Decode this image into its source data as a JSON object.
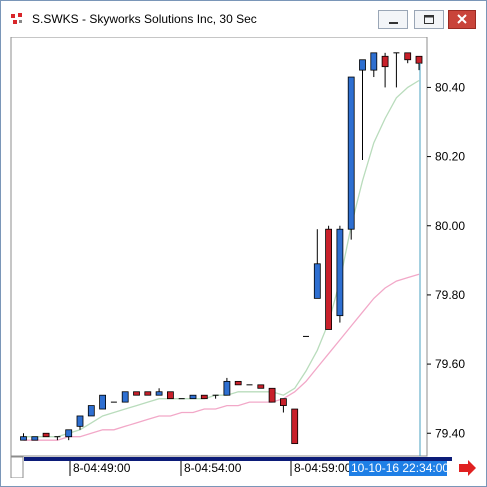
{
  "window": {
    "title": "S.SWKS - Skyworks Solutions Inc, 30 Sec",
    "colors": {
      "up": "#2e6fd1",
      "down": "#c8202a",
      "ma_fast": "#b9dcbc",
      "ma_slow": "#f2a8c8",
      "cursor": "#4aa0c0",
      "time_highlight": "#1e7fe6",
      "scroll_bar": "#0c1c78"
    }
  },
  "chart_data": {
    "type": "candlestick",
    "ylim": [
      79.34,
      80.54
    ],
    "y_ticks": [
      "80.40",
      "80.20",
      "80.00",
      "79.80",
      "79.60",
      "79.40"
    ],
    "x_labels": [
      "8-04:49:00",
      "8-04:54:00",
      "8-04:59:00"
    ],
    "cursor_time": "10-10-16 22:34:00",
    "candles": [
      {
        "o": 79.38,
        "h": 79.4,
        "l": 79.38,
        "c": 79.39
      },
      {
        "o": 79.38,
        "h": 79.39,
        "l": 79.38,
        "c": 79.39
      },
      {
        "o": 79.4,
        "h": 79.4,
        "l": 79.39,
        "c": 79.39
      },
      {
        "o": 79.39,
        "h": 79.39,
        "l": 79.38,
        "c": 79.39
      },
      {
        "o": 79.39,
        "h": 79.41,
        "l": 79.38,
        "c": 79.41
      },
      {
        "o": 79.42,
        "h": 79.45,
        "l": 79.41,
        "c": 79.45
      },
      {
        "o": 79.45,
        "h": 79.48,
        "l": 79.45,
        "c": 79.48
      },
      {
        "o": 79.47,
        "h": 79.51,
        "l": 79.47,
        "c": 79.51
      },
      {
        "o": 79.49,
        "h": 79.49,
        "l": 79.49,
        "c": 79.49
      },
      {
        "o": 79.49,
        "h": 79.52,
        "l": 79.49,
        "c": 79.52
      },
      {
        "o": 79.52,
        "h": 79.52,
        "l": 79.51,
        "c": 79.51
      },
      {
        "o": 79.52,
        "h": 79.52,
        "l": 79.51,
        "c": 79.51
      },
      {
        "o": 79.51,
        "h": 79.53,
        "l": 79.51,
        "c": 79.52
      },
      {
        "o": 79.52,
        "h": 79.52,
        "l": 79.5,
        "c": 79.5
      },
      {
        "o": 79.5,
        "h": 79.5,
        "l": 79.5,
        "c": 79.5
      },
      {
        "o": 79.5,
        "h": 79.51,
        "l": 79.5,
        "c": 79.51
      },
      {
        "o": 79.51,
        "h": 79.51,
        "l": 79.5,
        "c": 79.5
      },
      {
        "o": 79.51,
        "h": 79.51,
        "l": 79.5,
        "c": 79.51
      },
      {
        "o": 79.51,
        "h": 79.56,
        "l": 79.51,
        "c": 79.55
      },
      {
        "o": 79.55,
        "h": 79.55,
        "l": 79.54,
        "c": 79.54
      },
      {
        "o": 79.54,
        "h": 79.54,
        "l": 79.54,
        "c": 79.54
      },
      {
        "o": 79.54,
        "h": 79.54,
        "l": 79.53,
        "c": 79.53
      },
      {
        "o": 79.53,
        "h": 79.53,
        "l": 79.49,
        "c": 79.49
      },
      {
        "o": 79.5,
        "h": 79.5,
        "l": 79.46,
        "c": 79.48
      },
      {
        "o": 79.47,
        "h": 79.47,
        "l": 79.37,
        "c": 79.37
      },
      {
        "o": 79.68,
        "h": 79.68,
        "l": 79.68,
        "c": 79.68
      },
      {
        "o": 79.79,
        "h": 79.99,
        "l": 79.79,
        "c": 79.89
      },
      {
        "o": 79.99,
        "h": 80.0,
        "l": 79.7,
        "c": 79.7
      },
      {
        "o": 79.74,
        "h": 80.0,
        "l": 79.72,
        "c": 79.99
      },
      {
        "o": 79.99,
        "h": 80.43,
        "l": 79.96,
        "c": 80.43
      },
      {
        "o": 80.45,
        "h": 80.48,
        "l": 80.19,
        "c": 80.48
      },
      {
        "o": 80.45,
        "h": 80.5,
        "l": 80.43,
        "c": 80.5
      },
      {
        "o": 80.49,
        "h": 80.5,
        "l": 80.4,
        "c": 80.46
      },
      {
        "o": 80.5,
        "h": 80.5,
        "l": 80.4,
        "c": 80.5
      },
      {
        "o": 80.5,
        "h": 80.5,
        "l": 80.47,
        "c": 80.48
      },
      {
        "o": 80.49,
        "h": 80.49,
        "l": 80.45,
        "c": 80.47
      }
    ],
    "ma_fast": [
      79.39,
      79.39,
      79.39,
      79.39,
      79.4,
      79.41,
      79.43,
      79.45,
      79.46,
      79.47,
      79.48,
      79.49,
      79.5,
      79.5,
      79.5,
      79.5,
      79.5,
      79.51,
      79.51,
      79.52,
      79.52,
      79.52,
      79.52,
      79.51,
      79.53,
      79.58,
      79.64,
      79.72,
      79.84,
      80.0,
      80.13,
      80.24,
      80.31,
      80.37,
      80.4,
      80.42
    ],
    "ma_slow": [
      79.38,
      79.38,
      79.38,
      79.38,
      79.39,
      79.39,
      79.4,
      79.41,
      79.41,
      79.42,
      79.43,
      79.44,
      79.45,
      79.45,
      79.46,
      79.46,
      79.47,
      79.47,
      79.48,
      79.48,
      79.49,
      79.49,
      79.49,
      79.5,
      79.52,
      79.55,
      79.59,
      79.63,
      79.67,
      79.71,
      79.75,
      79.79,
      79.82,
      79.84,
      79.85,
      79.86
    ]
  }
}
